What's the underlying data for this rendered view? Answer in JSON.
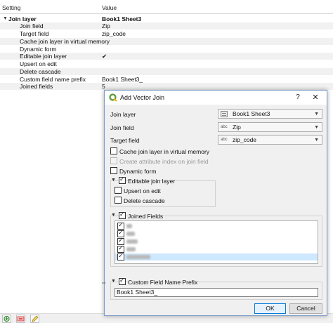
{
  "settings": {
    "columns": {
      "setting": "Setting",
      "value": "Value"
    },
    "group": {
      "label": "Join layer",
      "value": "Book1 Sheet3"
    },
    "rows": [
      {
        "label": "Join field",
        "value": "Zip"
      },
      {
        "label": "Target field",
        "value": "zip_code"
      },
      {
        "label": "Cache join layer in virtual memory",
        "value": ""
      },
      {
        "label": "Dynamic form",
        "value": ""
      },
      {
        "label": "Editable join layer",
        "value": "✔"
      },
      {
        "label": "Upsert on edit",
        "value": ""
      },
      {
        "label": "Delete cascade",
        "value": ""
      },
      {
        "label": "Custom field name prefix",
        "value": "Book1 Sheet3_"
      },
      {
        "label": "Joined fields",
        "value": "5"
      }
    ]
  },
  "toolbar": {
    "buttons": [
      {
        "icon": "add-join-icon",
        "color": "#2e8b2e"
      },
      {
        "icon": "remove-join-icon",
        "color": "#cc2222"
      },
      {
        "icon": "edit-join-icon",
        "color": "#d4a017"
      }
    ]
  },
  "dialog": {
    "title": "Add Vector Join",
    "help": "?",
    "close": "✕",
    "join_layer": {
      "label": "Join layer",
      "value": "Book1 Sheet3",
      "icon": "layer-icon"
    },
    "join_field": {
      "label": "Join field",
      "prefix": "abc",
      "value": "Zip"
    },
    "target_field": {
      "label": "Target field",
      "prefix": "abc",
      "value": "zip_code"
    },
    "cache_label": "Cache join layer in virtual memory",
    "attr_index_label": "Create attribute index on join field",
    "dynamic_form_label": "Dynamic form",
    "editable_label": "Editable join layer",
    "upsert_label": "Upsert on edit",
    "delete_cascade_label": "Delete cascade",
    "joined_fields_label": "Joined Fields",
    "joined_fields_count": 5,
    "prefix_label": "Custom Field Name Prefix",
    "prefix_value": "Book1 Sheet3_",
    "ok": "OK",
    "cancel": "Cancel"
  },
  "colors": {
    "selection": "#cde8ff",
    "accent": "#0078d7",
    "qgis_green": "#589632"
  }
}
